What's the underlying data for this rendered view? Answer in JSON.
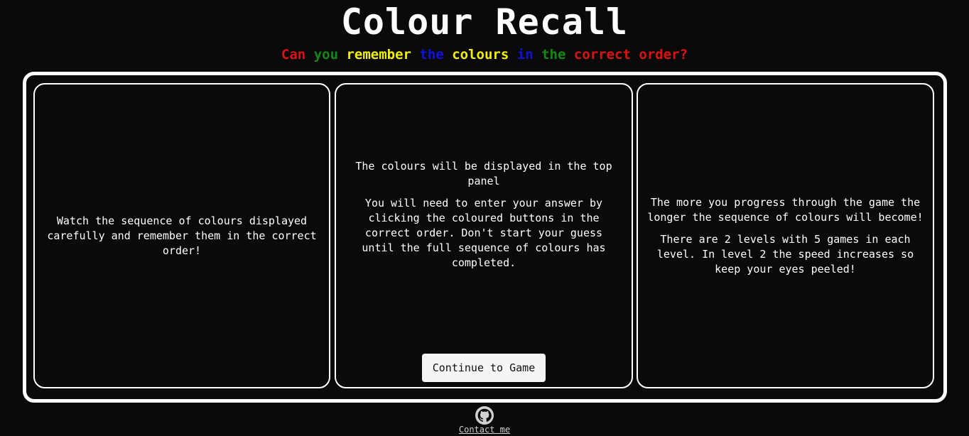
{
  "header": {
    "title": "Colour Recall",
    "subtitle_words": [
      {
        "text": "Can",
        "color": "#e01010"
      },
      {
        "text": "you",
        "color": "#108a10"
      },
      {
        "text": "remember",
        "color": "#f0f000"
      },
      {
        "text": "the",
        "color": "#1010e0"
      },
      {
        "text": "colours",
        "color": "#f0f000"
      },
      {
        "text": "in",
        "color": "#1010e0"
      },
      {
        "text": "the",
        "color": "#108a10"
      },
      {
        "text": "correct",
        "color": "#e01010"
      },
      {
        "text": "order?",
        "color": "#e01010"
      }
    ]
  },
  "panels": [
    {
      "paragraphs": [
        "Watch the sequence of colours displayed carefully and remember them in the correct order!"
      ]
    },
    {
      "paragraphs": [
        "The colours will be displayed in the top panel",
        "You will need to enter your answer by clicking the coloured buttons in the correct order. Don't start your guess until the full sequence of colours has completed."
      ],
      "button_label": "Continue to Game"
    },
    {
      "paragraphs": [
        "The more you progress through the game the longer the sequence of colours will become!",
        "There are 2 levels with 5 games in each level. In level 2 the speed increases so keep your eyes peeled!"
      ]
    }
  ],
  "footer": {
    "icon": "github-icon",
    "contact_label": "Contact me"
  }
}
